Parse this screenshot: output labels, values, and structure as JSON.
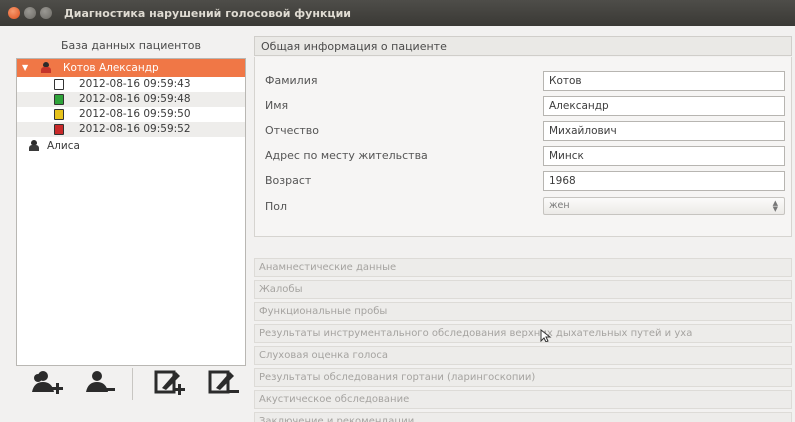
{
  "window": {
    "title": "Диагностика нарушений голосовой функции",
    "controls": [
      "close-icon",
      "minimize-icon",
      "maximize-icon"
    ]
  },
  "left_panel": {
    "header": "База данных пациентов",
    "patients": [
      {
        "name": "Котов Александр",
        "selected": true,
        "records": [
          {
            "label": "2012-08-16 09:59:43",
            "icon": "edit-record-icon",
            "color": "#ffffff"
          },
          {
            "label": "2012-08-16 09:59:48",
            "icon": "edit-record-icon",
            "color": "#2fa33a"
          },
          {
            "label": "2012-08-16 09:59:50",
            "icon": "edit-record-icon",
            "color": "#e7c21b"
          },
          {
            "label": "2012-08-16 09:59:52",
            "icon": "edit-record-icon",
            "color": "#c92a2a"
          }
        ]
      },
      {
        "name": "Алиса",
        "selected": false,
        "records": []
      }
    ],
    "toolbar": [
      "add-patient-icon",
      "remove-patient-icon",
      "add-record-icon",
      "remove-record-icon"
    ]
  },
  "right_panel": {
    "header": "Общая информация о пациенте",
    "fields": {
      "surname": {
        "label": "Фамилия",
        "value": "Котов"
      },
      "name": {
        "label": "Имя",
        "value": "Александр"
      },
      "patronymic": {
        "label": "Отчество",
        "value": "Михайлович"
      },
      "address": {
        "label": "Адрес по месту жительства",
        "value": "Минск"
      },
      "birth_year": {
        "label": "Возраст",
        "value": "1968"
      },
      "sex": {
        "label": "Пол",
        "value": "жен"
      }
    },
    "sections": [
      "Анамнестические данные",
      "Жалобы",
      "Функциональные пробы",
      "Результаты инструментального обследования верхних дыхательных путей и уха",
      "Слуховая оценка голоса",
      "Результаты обследования гортани (ларингоскопии)",
      "Акустическое обследование",
      "Заключение и рекомендации"
    ]
  },
  "colors": {
    "accent": "#f07746",
    "titlebar": "#3c3b37",
    "window_bg": "#f2f1f0"
  }
}
